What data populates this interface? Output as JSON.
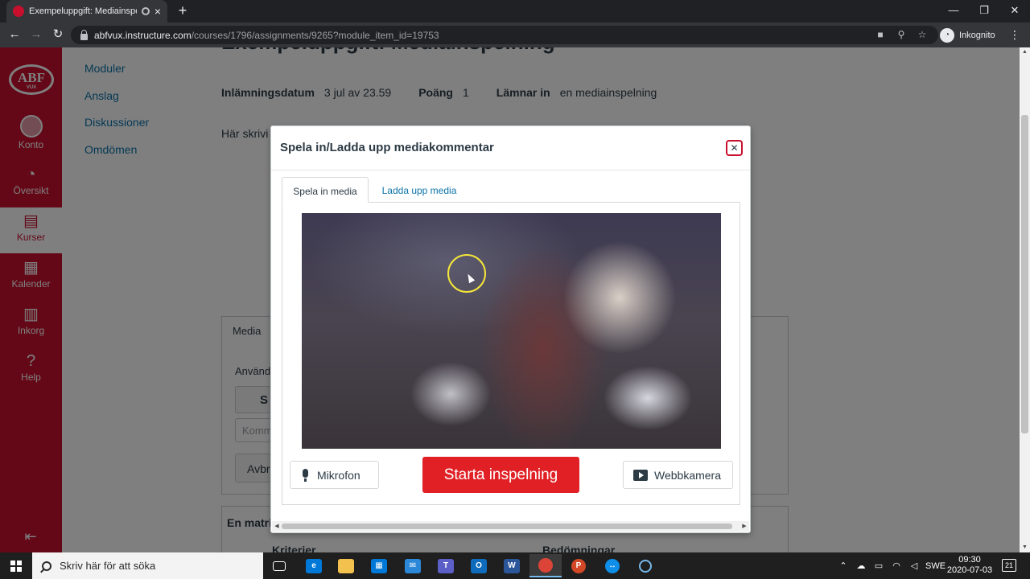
{
  "browser": {
    "tab_title": "Exempeluppgift: Mediainspe",
    "tab_close": "×",
    "new_tab": "+",
    "url_host": "abfvux.instructure.com",
    "url_path": "/courses/1796/assignments/9265?module_item_id=19753",
    "profile_label": "Inkognito",
    "win_minimize": "—",
    "win_restore": "❐",
    "win_close": "✕"
  },
  "globalnav": {
    "logo": "ABF",
    "logo_sub": "VUX",
    "items": [
      {
        "label": "Konto",
        "icon": "account-icon"
      },
      {
        "label": "Översikt",
        "icon": "dashboard-icon"
      },
      {
        "label": "Kurser",
        "icon": "courses-icon"
      },
      {
        "label": "Kalender",
        "icon": "calendar-icon"
      },
      {
        "label": "Inkorg",
        "icon": "inbox-icon"
      },
      {
        "label": "Help",
        "icon": "help-icon"
      }
    ],
    "active_index": 2
  },
  "coursenav": {
    "items": [
      "Moduler",
      "Anslag",
      "Diskussioner",
      "Omdömen"
    ]
  },
  "assignment": {
    "title": "Exempeluppgift: Mediainspelning",
    "due_label": "Inlämningsdatum",
    "due_value": "3 jul av 23.59",
    "points_label": "Poäng",
    "points_value": "1",
    "submit_label": "Lämnar in",
    "submit_value": "en mediainspelning",
    "description": "Här skrivi"
  },
  "background": {
    "media_tab": "Media",
    "media_use": "Använd",
    "media_s": "S",
    "media_comment": "Komm",
    "media_cancel": "Avbr",
    "rubric_title": "En matri",
    "rubric_criteria": "Kriterier",
    "rubric_ratings": "Bedömningar"
  },
  "dialog": {
    "title": "Spela in/Ladda upp mediakommentar",
    "close": "✕",
    "tabs": [
      "Spela in media",
      "Ladda upp media"
    ],
    "active_tab": 0,
    "mic_label": "Mikrofon",
    "start_label": "Starta inspelning",
    "cam_label": "Webbkamera",
    "start_color": "#e02025"
  },
  "taskbar": {
    "search_placeholder": "Skriv här för att söka",
    "language": "SWE",
    "time": "09:30",
    "date": "2020-07-03",
    "notifications": "21"
  },
  "colors": {
    "brand": "#c8102e",
    "link": "#0b73a8"
  }
}
